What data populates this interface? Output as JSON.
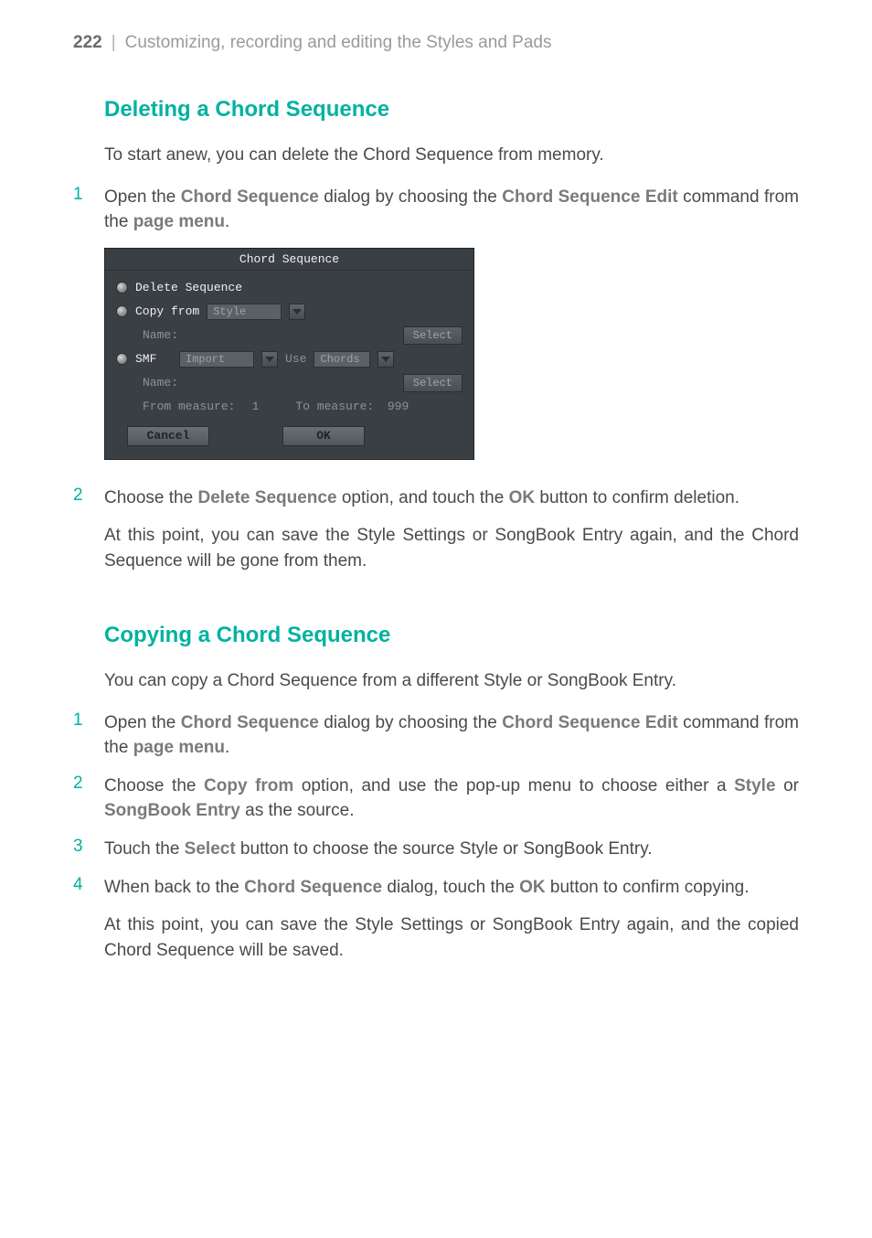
{
  "header": {
    "page_number": "222",
    "separator": "|",
    "title": "Customizing, recording and editing the Styles and Pads"
  },
  "section1": {
    "heading": "Deleting a Chord Sequence",
    "intro": "To start anew, you can delete the Chord Sequence from memory.",
    "step1": {
      "num": "1",
      "t1": "Open the ",
      "term1": "Chord Sequence",
      "t2": " dialog by choosing the ",
      "term2": "Chord Sequence Edit",
      "t3": " command from the ",
      "term3": "page menu",
      "t4": "."
    },
    "step2": {
      "num": "2",
      "t1": "Choose the ",
      "term1": "Delete Sequence",
      "t2": " option, and touch the ",
      "term2": "OK",
      "t3": " button to confirm deletion."
    },
    "after": "At this point, you can save the Style Settings or SongBook Entry again, and the Chord Sequence will be gone from them."
  },
  "dialog": {
    "title": "Chord Sequence",
    "delete_sequence": "Delete Sequence",
    "copy_from": "Copy from",
    "copy_from_value": "Style",
    "name1_label": "Name:",
    "select1": "Select",
    "smf": "SMF",
    "smf_value": "Import",
    "use_label": "Use",
    "use_value": "Chords",
    "name2_label": "Name:",
    "select2": "Select",
    "from_measure_label": "From measure:",
    "from_measure_value": "1",
    "to_measure_label": "To measure:",
    "to_measure_value": "999",
    "cancel": "Cancel",
    "ok": "OK"
  },
  "section2": {
    "heading": "Copying a Chord Sequence",
    "intro": "You can copy a Chord Sequence from a different Style or SongBook Entry.",
    "step1": {
      "num": "1",
      "t1": "Open the ",
      "term1": "Chord Sequence",
      "t2": " dialog by choosing the ",
      "term2": "Chord Sequence Edit",
      "t3": " command from the ",
      "term3": "page menu",
      "t4": "."
    },
    "step2": {
      "num": "2",
      "t1": "Choose the ",
      "term1": "Copy from",
      "t2": " option, and use the pop-up menu to choose either a ",
      "term2": "Style",
      "t3": " or ",
      "term3": "SongBook Entry",
      "t4": " as the source."
    },
    "step3": {
      "num": "3",
      "t1": "Touch the ",
      "term1": "Select",
      "t2": " button to choose the source Style or SongBook Entry."
    },
    "step4": {
      "num": "4",
      "t1": "When back to the ",
      "term1": "Chord Sequence",
      "t2": " dialog, touch the ",
      "term2": "OK",
      "t3": " button to confirm copying."
    },
    "after": "At this point, you can save the Style Settings or SongBook Entry again, and the copied Chord Sequence will be saved."
  }
}
